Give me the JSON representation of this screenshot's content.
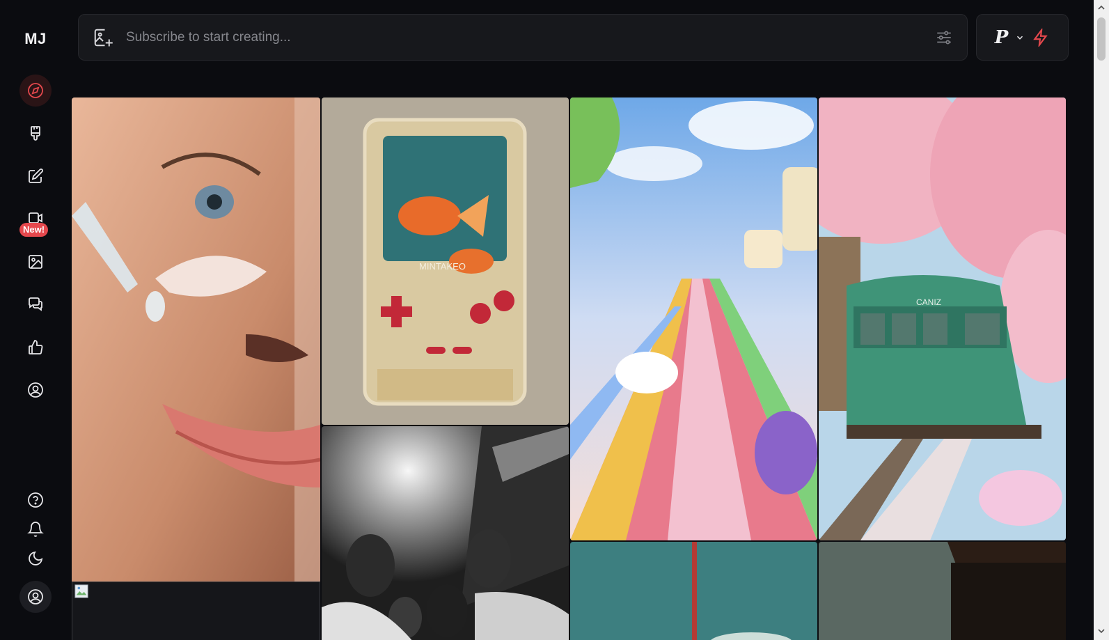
{
  "app": {
    "logo": "MJ"
  },
  "sidebar": {
    "items": [
      {
        "id": "explore",
        "icon": "compass-icon",
        "active": true
      },
      {
        "id": "create",
        "icon": "paintbrush-icon"
      },
      {
        "id": "edit",
        "icon": "edit-pencil-icon"
      },
      {
        "id": "video",
        "icon": "video-icon",
        "badge": "New!"
      },
      {
        "id": "organize",
        "icon": "image-icon"
      },
      {
        "id": "chat",
        "icon": "chat-bubbles-icon"
      },
      {
        "id": "rank",
        "icon": "thumbs-up-icon"
      },
      {
        "id": "profile",
        "icon": "user-circle-icon"
      }
    ],
    "bottom": [
      {
        "id": "help",
        "icon": "question-icon"
      },
      {
        "id": "notifications",
        "icon": "bell-icon"
      },
      {
        "id": "theme",
        "icon": "moon-icon"
      },
      {
        "id": "account",
        "icon": "account-icon"
      }
    ]
  },
  "prompt": {
    "placeholder": "Subscribe to start creating..."
  },
  "plan": {
    "letter": "P"
  },
  "colors": {
    "accent": "#e5484d",
    "background": "#0b0c10",
    "surface": "#17181c"
  },
  "gallery": {
    "images": [
      {
        "subject": "face-skincare-dropper"
      },
      {
        "subject": "goldfish-handheld-console",
        "text": "MINTAKEO"
      },
      {
        "subject": "rainbow-candy-road"
      },
      {
        "subject": "green-tram-cherry-blossoms",
        "text": "CANIZ"
      },
      {
        "subject": "broken-image"
      },
      {
        "subject": "monochrome-group-portrait"
      },
      {
        "subject": "teal-sky-pole"
      },
      {
        "subject": "rain-window"
      }
    ]
  }
}
